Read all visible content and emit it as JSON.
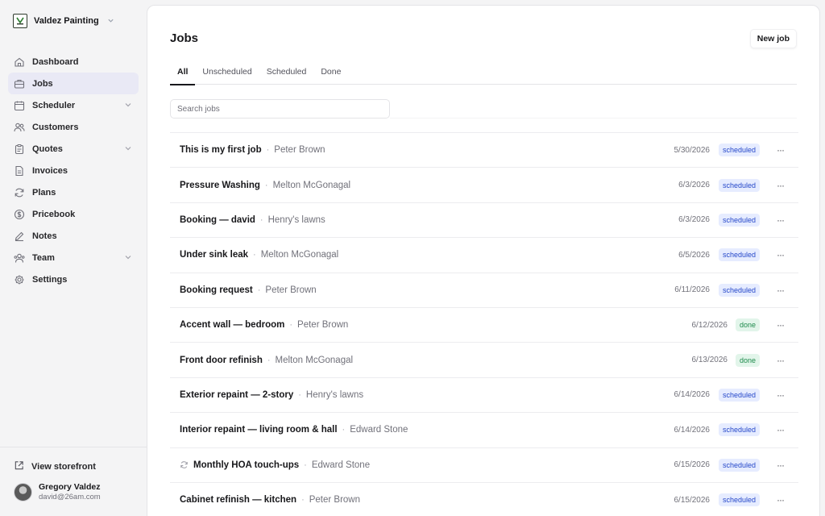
{
  "org": {
    "name": "Valdez Painting"
  },
  "sidebar": {
    "items": [
      {
        "label": "Dashboard",
        "icon": "home-icon",
        "has_chevron": false,
        "active": false
      },
      {
        "label": "Jobs",
        "icon": "briefcase-icon",
        "has_chevron": false,
        "active": true
      },
      {
        "label": "Scheduler",
        "icon": "calendar-icon",
        "has_chevron": true,
        "active": false
      },
      {
        "label": "Customers",
        "icon": "users-icon",
        "has_chevron": false,
        "active": false
      },
      {
        "label": "Quotes",
        "icon": "clipboard-icon",
        "has_chevron": true,
        "active": false
      },
      {
        "label": "Invoices",
        "icon": "file-icon",
        "has_chevron": false,
        "active": false
      },
      {
        "label": "Plans",
        "icon": "refresh-icon",
        "has_chevron": false,
        "active": false
      },
      {
        "label": "Pricebook",
        "icon": "dollar-icon",
        "has_chevron": false,
        "active": false
      },
      {
        "label": "Notes",
        "icon": "pencil-icon",
        "has_chevron": false,
        "active": false
      },
      {
        "label": "Team",
        "icon": "team-icon",
        "has_chevron": true,
        "active": false
      },
      {
        "label": "Settings",
        "icon": "gear-icon",
        "has_chevron": false,
        "active": false
      }
    ],
    "storefront_label": "View storefront",
    "user": {
      "name": "Gregory Valdez",
      "email": "david@26am.com"
    }
  },
  "main": {
    "title": "Jobs",
    "new_job_label": "New job",
    "tabs": [
      {
        "label": "All",
        "active": true
      },
      {
        "label": "Unscheduled",
        "active": false
      },
      {
        "label": "Scheduled",
        "active": false
      },
      {
        "label": "Done",
        "active": false
      }
    ],
    "search_placeholder": "Search jobs",
    "more_label": "···",
    "separator": "·",
    "jobs": [
      {
        "title": "This is my first job",
        "customer": "Peter Brown",
        "date": "5/30/2026",
        "status": "scheduled",
        "recurring": false
      },
      {
        "title": "Pressure Washing",
        "customer": "Melton McGonagal",
        "date": "6/3/2026",
        "status": "scheduled",
        "recurring": false
      },
      {
        "title": "Booking — david",
        "customer": "Henry's lawns",
        "date": "6/3/2026",
        "status": "scheduled",
        "recurring": false
      },
      {
        "title": "Under sink leak",
        "customer": "Melton McGonagal",
        "date": "6/5/2026",
        "status": "scheduled",
        "recurring": false
      },
      {
        "title": "Booking request",
        "customer": "Peter Brown",
        "date": "6/11/2026",
        "status": "scheduled",
        "recurring": false
      },
      {
        "title": "Accent wall — bedroom",
        "customer": "Peter Brown",
        "date": "6/12/2026",
        "status": "done",
        "recurring": false
      },
      {
        "title": "Front door refinish",
        "customer": "Melton McGonagal",
        "date": "6/13/2026",
        "status": "done",
        "recurring": false
      },
      {
        "title": "Exterior repaint — 2-story",
        "customer": "Henry's lawns",
        "date": "6/14/2026",
        "status": "scheduled",
        "recurring": false
      },
      {
        "title": "Interior repaint — living room & hall",
        "customer": "Edward Stone",
        "date": "6/14/2026",
        "status": "scheduled",
        "recurring": false
      },
      {
        "title": "Monthly HOA touch-ups",
        "customer": "Edward Stone",
        "date": "6/15/2026",
        "status": "scheduled",
        "recurring": true
      },
      {
        "title": "Cabinet refinish — kitchen",
        "customer": "Peter Brown",
        "date": "6/15/2026",
        "status": "scheduled",
        "recurring": false
      }
    ]
  },
  "colors": {
    "accent_active_bg": "#e9e9f5",
    "scheduled_badge": "#2547c9",
    "done_badge": "#1f8a4c"
  }
}
